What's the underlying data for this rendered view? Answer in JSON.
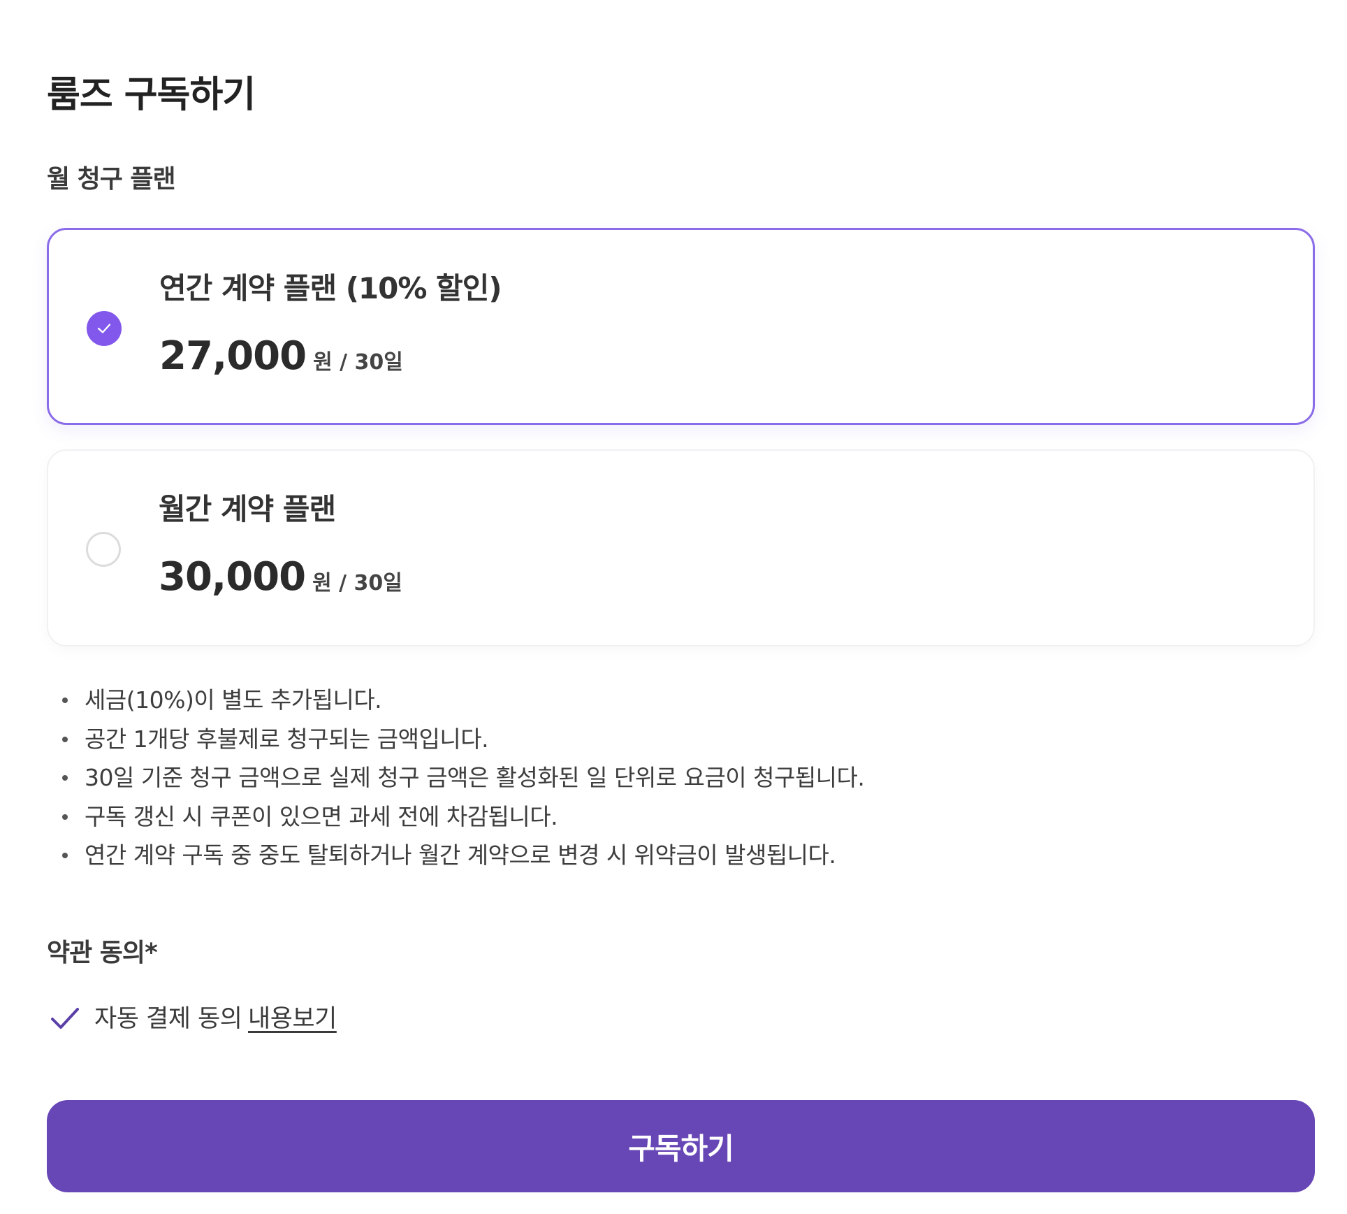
{
  "title": "룸즈 구독하기",
  "plan_section": {
    "label": "월 청구 플랜",
    "plans": [
      {
        "name": "연간 계약 플랜 (10% 할인)",
        "price": "27,000",
        "unit": "원 / 30일",
        "selected": true
      },
      {
        "name": "월간 계약 플랜",
        "price": "30,000",
        "unit": "원 / 30일",
        "selected": false
      }
    ]
  },
  "notes": [
    "세금(10%)이 별도 추가됩니다.",
    "공간 1개당 후불제로 청구되는 금액입니다.",
    "30일 기준 청구 금액으로 실제 청구 금액은 활성화된 일 단위로 요금이 청구됩니다.",
    "구독 갱신 시 쿠폰이 있으면 과세 전에 차감됩니다.",
    "연간 계약 구독 중 중도 탈퇴하거나 월간 계약으로 변경 시 위약금이 발생됩니다."
  ],
  "terms": {
    "label": "약관 동의*",
    "auto_payment_label": "자동 결제 동의",
    "auto_payment_checked": true,
    "view_link": "내용보기"
  },
  "submit_label": "구독하기",
  "colors": {
    "accent": "#8157ec",
    "selected_border": "#8b6ce8",
    "button": "#6746b5",
    "check": "#5a3fa8"
  }
}
